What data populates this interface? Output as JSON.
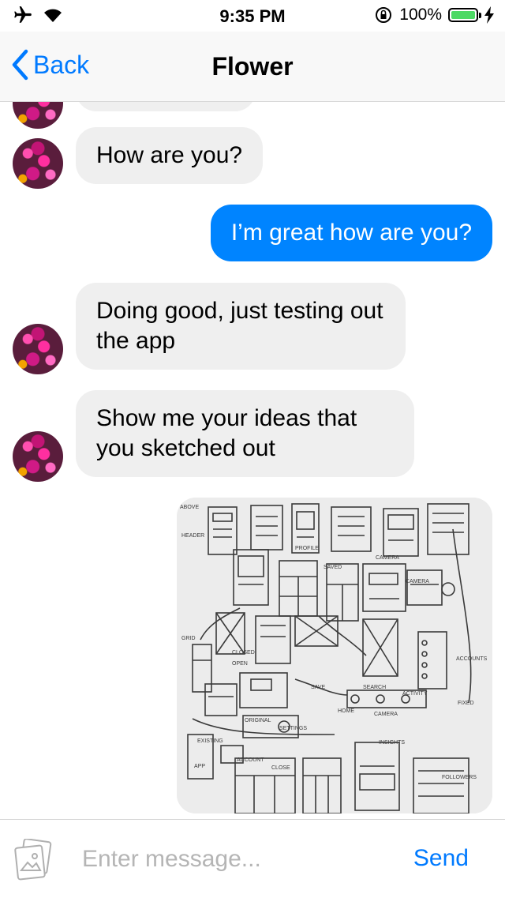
{
  "status_bar": {
    "time": "9:35 PM",
    "battery_percent": "100%",
    "battery_level": 1.0,
    "icons": [
      "airplane-icon",
      "wifi-icon",
      "orientation-lock-icon",
      "battery-icon",
      "charging-bolt-icon"
    ]
  },
  "nav": {
    "back_label": "Back",
    "title": "Flower"
  },
  "messages": [
    {
      "direction": "incoming",
      "text": "How are you?"
    },
    {
      "direction": "outgoing",
      "text": "I’m great how are you?"
    },
    {
      "direction": "incoming",
      "text": "Doing good, just testing out the app"
    },
    {
      "direction": "incoming",
      "text": "Show me your ideas that you sketched out"
    },
    {
      "direction": "outgoing",
      "type": "image",
      "image": "sketch-photo"
    }
  ],
  "compose": {
    "placeholder": "Enter message...",
    "send_label": "Send"
  },
  "colors": {
    "accent": "#007aff",
    "outgoing_bubble": "#0084ff",
    "incoming_bubble": "#efefef",
    "battery": "#4cd964"
  }
}
